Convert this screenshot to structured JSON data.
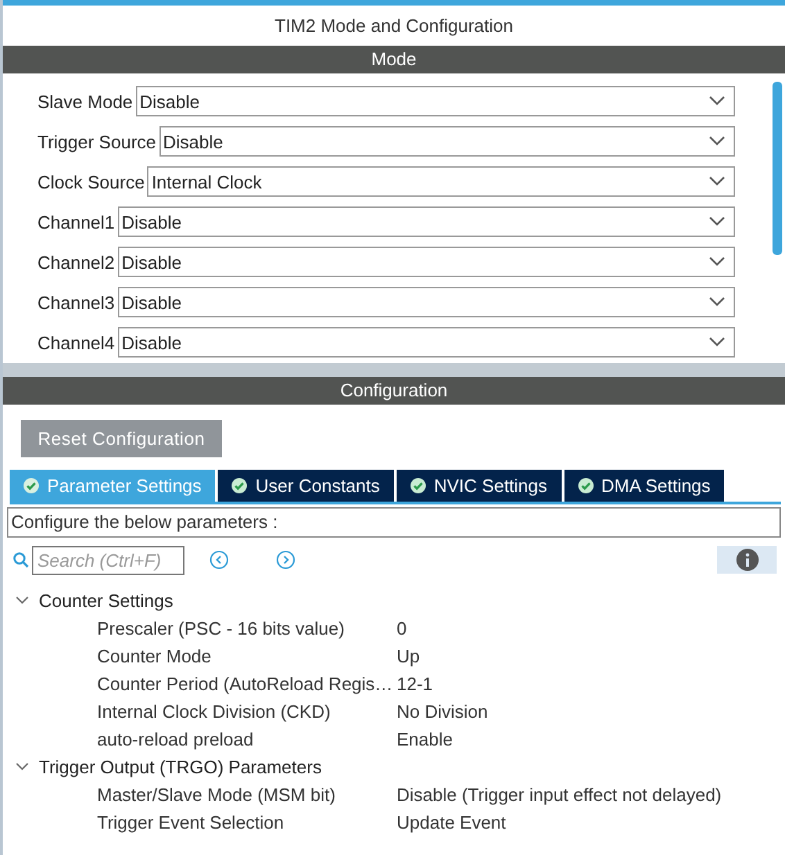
{
  "window": {
    "title": "TIM2 Mode and Configuration"
  },
  "mode": {
    "header": "Mode",
    "fields": [
      {
        "label": "Slave Mode",
        "value": "Disable"
      },
      {
        "label": "Trigger Source",
        "value": "Disable"
      },
      {
        "label": "Clock Source",
        "value": "Internal Clock"
      },
      {
        "label": "Channel1",
        "value": "Disable"
      },
      {
        "label": "Channel2",
        "value": "Disable"
      },
      {
        "label": "Channel3",
        "value": "Disable"
      },
      {
        "label": "Channel4",
        "value": "Disable"
      }
    ]
  },
  "configuration": {
    "header": "Configuration",
    "reset_button": "Reset Configuration",
    "tabs": [
      {
        "label": "Parameter Settings",
        "selected": true
      },
      {
        "label": "User Constants",
        "selected": false
      },
      {
        "label": "NVIC Settings",
        "selected": false
      },
      {
        "label": "DMA Settings",
        "selected": false
      }
    ],
    "description": "Configure the below parameters :",
    "search": {
      "placeholder": "Search (Ctrl+F)"
    },
    "groups": [
      {
        "name": "Counter Settings",
        "expanded": true,
        "children": [
          {
            "name": "Prescaler (PSC - 16 bits value)",
            "value": "0"
          },
          {
            "name": "Counter Mode",
            "value": "Up"
          },
          {
            "name": "Counter Period (AutoReload Regis…",
            "value": "12-1"
          },
          {
            "name": "Internal Clock Division (CKD)",
            "value": "No Division"
          },
          {
            "name": "auto-reload preload",
            "value": "Enable"
          }
        ]
      },
      {
        "name": "Trigger Output (TRGO) Parameters",
        "expanded": true,
        "children": [
          {
            "name": "Master/Slave Mode (MSM bit)",
            "value": "Disable (Trigger input effect not delayed)"
          },
          {
            "name": "Trigger Event Selection",
            "value": "Update Event"
          }
        ]
      }
    ]
  }
}
